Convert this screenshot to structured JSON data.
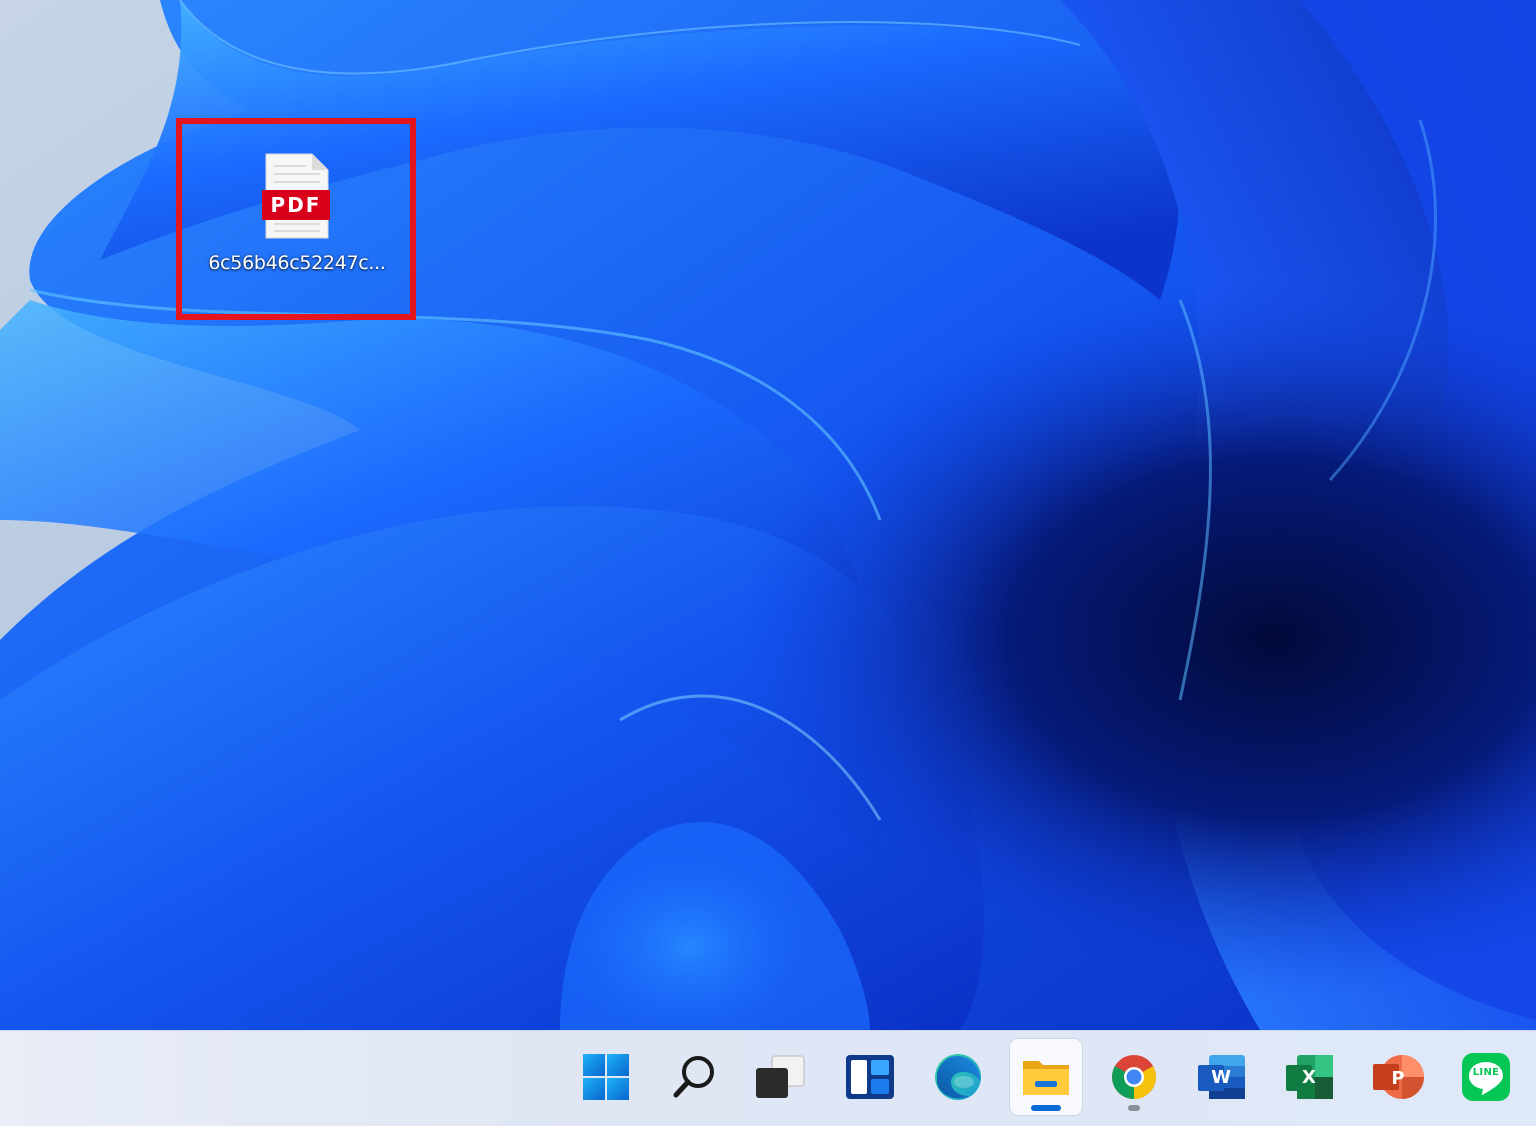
{
  "desktop": {
    "icons": [
      {
        "label": "6c56b46c52247c...",
        "type_badge": "PDF",
        "icon": "pdf-file-icon",
        "highlighted": true
      }
    ]
  },
  "taskbar": {
    "apps": [
      {
        "name": "start",
        "icon": "windows-start-icon",
        "state": "idle"
      },
      {
        "name": "search",
        "icon": "search-icon",
        "state": "idle"
      },
      {
        "name": "task-view",
        "icon": "task-view-icon",
        "state": "idle"
      },
      {
        "name": "widgets",
        "icon": "widgets-icon",
        "state": "idle"
      },
      {
        "name": "edge",
        "icon": "edge-browser-icon",
        "state": "idle"
      },
      {
        "name": "file-explorer",
        "icon": "file-explorer-icon",
        "state": "active"
      },
      {
        "name": "chrome",
        "icon": "chrome-browser-icon",
        "state": "running"
      },
      {
        "name": "word",
        "icon": "word-icon",
        "badge": "W",
        "state": "idle"
      },
      {
        "name": "excel",
        "icon": "excel-icon",
        "badge": "X",
        "state": "idle"
      },
      {
        "name": "powerpoint",
        "icon": "powerpoint-icon",
        "badge": "P",
        "state": "idle"
      },
      {
        "name": "line",
        "icon": "line-app-icon",
        "badge": "LINE",
        "state": "idle"
      }
    ]
  },
  "colors": {
    "highlight": "#e3151f",
    "accent": "#0a6cd6",
    "pdf_badge": "#d9001b"
  }
}
